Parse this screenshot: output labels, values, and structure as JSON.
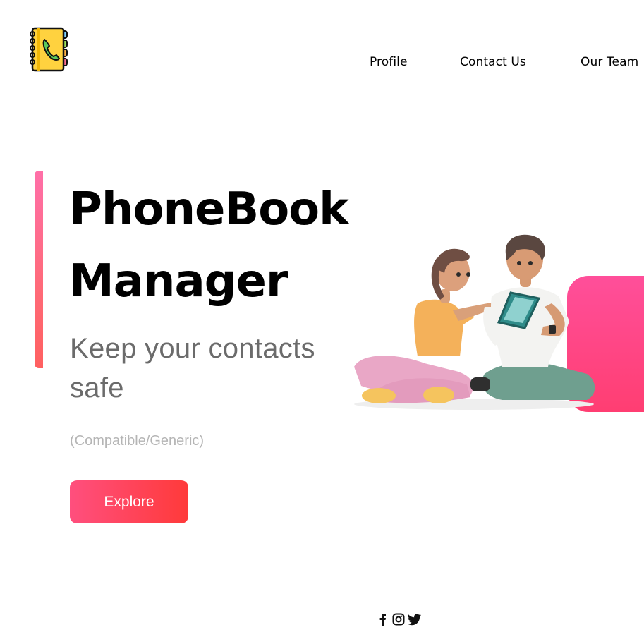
{
  "nav": {
    "items": [
      "Profile",
      "Contact Us",
      "Our Team"
    ]
  },
  "hero": {
    "title_line1": "PhoneBook",
    "title_line2": "Manager",
    "subtitle": "Keep your contacts safe",
    "note": "(Compatible/Generic)",
    "cta_label": "Explore"
  },
  "icons": {
    "logo": "phonebook-logo-icon",
    "social": [
      "facebook-icon",
      "instagram-icon",
      "twitter-icon"
    ]
  },
  "colors": {
    "accent_start": "#ff4f7e",
    "accent_end": "#ff3a3a",
    "hero_panel": "#ff4f9a"
  }
}
